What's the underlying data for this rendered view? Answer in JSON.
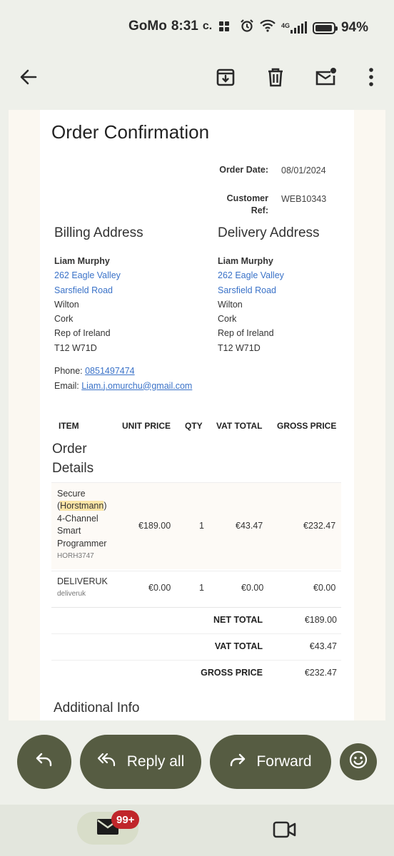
{
  "status_bar": {
    "carrier": "GoMo",
    "time": "8:31",
    "carrier_mark": "c.",
    "network": "4G",
    "battery": "94%"
  },
  "toolbar": {
    "icons": [
      "back-arrow-icon",
      "archive-icon",
      "delete-icon",
      "mark-unread-icon",
      "more-vert-icon"
    ]
  },
  "email": {
    "title": "Order Confirmation",
    "meta": [
      {
        "label": "Order Date:",
        "value": "08/01/2024"
      },
      {
        "label": "Customer Ref:",
        "value": "WEB10343"
      }
    ],
    "billing": {
      "heading": "Billing Address",
      "name": "Liam Murphy",
      "line1": "262 Eagle Valley",
      "line2": "Sarsfield Road",
      "line3": "Wilton",
      "line4": "Cork",
      "line5": "Rep of Ireland",
      "line6": "T12 W71D"
    },
    "delivery": {
      "heading": "Delivery Address",
      "name": "Liam Murphy",
      "line1": "262 Eagle Valley",
      "line2": "Sarsfield Road",
      "line3": "Wilton",
      "line4": "Cork",
      "line5": "Rep of Ireland",
      "line6": "T12 W71D"
    },
    "phone_label": "Phone:",
    "phone": "0851497474",
    "email_label": "Email:",
    "email": "Liam.j.omurchu@gmail.com",
    "table": {
      "headers": [
        "ITEM",
        "UNIT PRICE",
        "QTY",
        "VAT TOTAL",
        "GROSS PRICE"
      ],
      "section_title_1": "Order",
      "section_title_2": "Details",
      "rows": [
        {
          "name_1": "Secure",
          "name_2_pre": "(",
          "name_2_hl": "Horstmann",
          "name_2_post": ")",
          "name_3": "4-Channel",
          "name_4": "Smart",
          "name_5": "Programmer",
          "sku": "HORH3747",
          "unit_price": "€189.00",
          "qty": "1",
          "vat_total": "€43.47",
          "gross_price": "€232.47"
        },
        {
          "name_1": "DELIVERUK",
          "sku": "deliveruk",
          "unit_price": "€0.00",
          "qty": "1",
          "vat_total": "€0.00",
          "gross_price": "€0.00"
        }
      ],
      "totals": [
        {
          "label": "NET TOTAL",
          "value": "€189.00"
        },
        {
          "label": "VAT TOTAL",
          "value": "€43.47"
        },
        {
          "label": "GROSS PRICE",
          "value": "€232.47"
        }
      ]
    },
    "additional_info": "Additional Info"
  },
  "actions": {
    "reply_icon": "reply-icon",
    "reply_all": "Reply all",
    "forward": "Forward",
    "emoji_icon": "emoji-icon"
  },
  "nav": {
    "mail_badge": "99+",
    "icons": [
      "mail-icon",
      "video-icon"
    ]
  },
  "colors": {
    "background": "#eef0ea",
    "action_pill": "#565c42",
    "link": "#3a72c8",
    "badge": "#c0262a",
    "highlight": "#fbe5a6"
  }
}
